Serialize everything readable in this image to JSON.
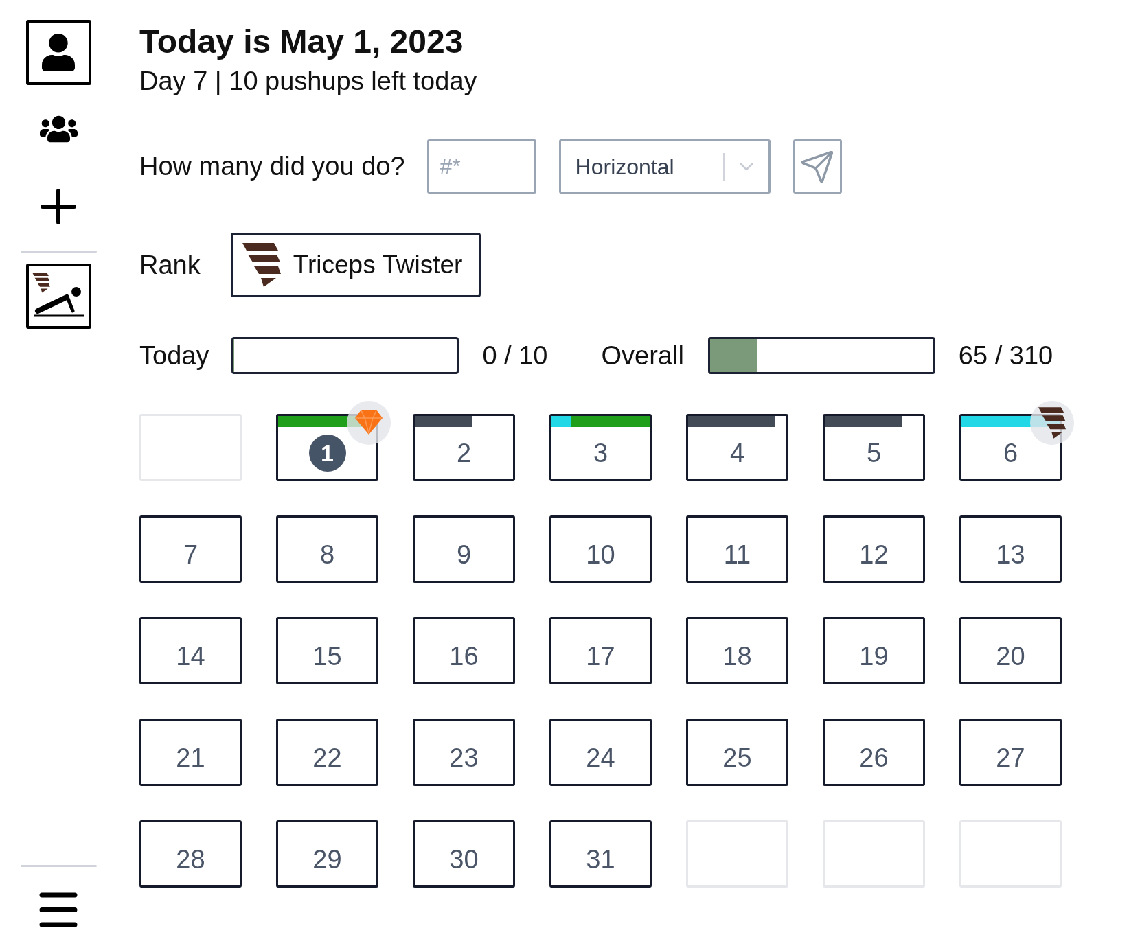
{
  "sidebar": {
    "challenges": [
      {
        "selected": true
      }
    ]
  },
  "header": {
    "title": "Today is May 1, 2023",
    "subtitle": "Day 7 | 10 pushups left today"
  },
  "log_form": {
    "label": "How many did you do?",
    "count": {
      "placeholder": "#*"
    },
    "type": {
      "value": "Horizontal"
    }
  },
  "rank": {
    "label": "Rank",
    "name": "Triceps Twister"
  },
  "progress": [
    {
      "label": "Today",
      "level": 0,
      "reading": "0 / 10"
    },
    {
      "label": "Overall",
      "level": 0.21,
      "reading": "65 / 310"
    }
  ],
  "calendar": {
    "days": [
      {
        "kind": "blank"
      },
      {
        "kind": "day",
        "number": "1",
        "today": true,
        "badge": {
          "kind": "gem"
        },
        "bars": [
          {
            "color": "#1f9f1a",
            "level": 1
          }
        ]
      },
      {
        "kind": "day",
        "number": "2",
        "today": false,
        "bars": [
          {
            "color": "#434b57",
            "level": 0.58
          }
        ]
      },
      {
        "kind": "day",
        "number": "3",
        "today": false,
        "bars": [
          {
            "color": "#22d8e6",
            "level": 0.2
          },
          {
            "color": "#1f9f1a",
            "level": 0.8
          }
        ]
      },
      {
        "kind": "day",
        "number": "4",
        "today": false,
        "bars": [
          {
            "color": "#434b57",
            "level": 0.88
          }
        ]
      },
      {
        "kind": "day",
        "number": "5",
        "today": false,
        "bars": [
          {
            "color": "#434b57",
            "level": 0.78
          }
        ]
      },
      {
        "kind": "day",
        "number": "6",
        "today": false,
        "badge": {
          "kind": "tornado"
        },
        "bars": [
          {
            "color": "#22d8e6",
            "level": 1
          }
        ]
      },
      {
        "kind": "day",
        "number": "7",
        "today": false
      },
      {
        "kind": "day",
        "number": "8",
        "today": false
      },
      {
        "kind": "day",
        "number": "9",
        "today": false
      },
      {
        "kind": "day",
        "number": "10",
        "today": false
      },
      {
        "kind": "day",
        "number": "11",
        "today": false
      },
      {
        "kind": "day",
        "number": "12",
        "today": false
      },
      {
        "kind": "day",
        "number": "13",
        "today": false
      },
      {
        "kind": "day",
        "number": "14",
        "today": false
      },
      {
        "kind": "day",
        "number": "15",
        "today": false
      },
      {
        "kind": "day",
        "number": "16",
        "today": false
      },
      {
        "kind": "day",
        "number": "17",
        "today": false
      },
      {
        "kind": "day",
        "number": "18",
        "today": false
      },
      {
        "kind": "day",
        "number": "19",
        "today": false
      },
      {
        "kind": "day",
        "number": "20",
        "today": false
      },
      {
        "kind": "day",
        "number": "21",
        "today": false
      },
      {
        "kind": "day",
        "number": "22",
        "today": false
      },
      {
        "kind": "day",
        "number": "23",
        "today": false
      },
      {
        "kind": "day",
        "number": "24",
        "today": false
      },
      {
        "kind": "day",
        "number": "25",
        "today": false
      },
      {
        "kind": "day",
        "number": "26",
        "today": false
      },
      {
        "kind": "day",
        "number": "27",
        "today": false
      },
      {
        "kind": "day",
        "number": "28",
        "today": false
      },
      {
        "kind": "day",
        "number": "29",
        "today": false
      },
      {
        "kind": "day",
        "number": "30",
        "today": false
      },
      {
        "kind": "day",
        "number": "31",
        "today": false
      },
      {
        "kind": "blank"
      },
      {
        "kind": "blank"
      },
      {
        "kind": "blank"
      }
    ]
  }
}
